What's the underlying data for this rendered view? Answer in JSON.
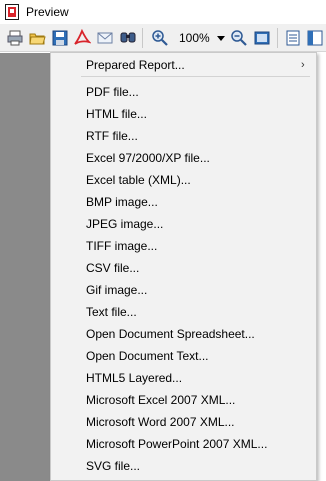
{
  "window": {
    "title": "Preview"
  },
  "toolbar": {
    "zoom_value": "100%",
    "icons": [
      "print-icon",
      "open-icon",
      "save-icon",
      "pdf-icon",
      "email-icon",
      "find-icon",
      "zoom-in-icon",
      "zoom-out-icon",
      "fit-page-icon",
      "page-setup-icon",
      "outline-icon"
    ]
  },
  "menu": {
    "header_item": "Prepared Report...",
    "items": [
      "PDF file...",
      "HTML file...",
      "RTF file...",
      "Excel 97/2000/XP file...",
      "Excel table (XML)...",
      "BMP image...",
      "JPEG image...",
      "TIFF image...",
      "CSV file...",
      "Gif image...",
      "Text file...",
      "Open Document Spreadsheet...",
      "Open Document Text...",
      "HTML5 Layered...",
      "Microsoft Excel 2007 XML...",
      "Microsoft Word 2007 XML...",
      "Microsoft PowerPoint 2007 XML...",
      "SVG file..."
    ]
  },
  "colors": {
    "menu_bg": "#f2f2f2",
    "preview_bg": "#7f7f7f",
    "toolbar_bg": "#f0f0f0",
    "accent_red": "#d8242b",
    "icon_blue": "#2f6fb7"
  }
}
